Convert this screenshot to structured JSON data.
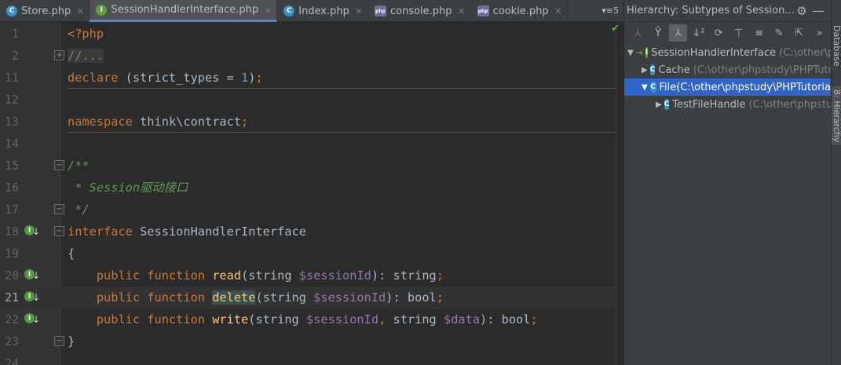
{
  "tabs": [
    {
      "label": "Store.php",
      "icon": "class-icon",
      "type": "class",
      "active": false
    },
    {
      "label": "SessionHandlerInterface.php",
      "icon": "interface-icon",
      "type": "iface",
      "active": true
    },
    {
      "label": "Index.php",
      "icon": "class-icon",
      "type": "class",
      "active": false
    },
    {
      "label": "console.php",
      "icon": "php-file-icon",
      "type": "php",
      "active": false
    },
    {
      "label": "cookie.php",
      "icon": "php-file-icon",
      "type": "php",
      "active": false
    }
  ],
  "tab_close_glyph": "×",
  "tab_overflow": "▾≡5",
  "editor": {
    "lines": [
      {
        "num": "1",
        "html": "<span class='kw'>&lt;?php</span>"
      },
      {
        "num": "2",
        "fold": "+",
        "html": "<span class='fold-box'>//...</span>"
      },
      {
        "num": "11",
        "html": "<span class='kw'>declare</span> (strict_types = <span class='num'>1</span>)<span class='kw'>;</span>"
      },
      {
        "num": "12",
        "html": ""
      },
      {
        "num": "13",
        "html": "<span class='kw'>namespace</span> think\\contract<span class='kw'>;</span>"
      },
      {
        "num": "14",
        "html": ""
      },
      {
        "num": "15",
        "fold": "−",
        "html": "<span class='cmt'>/**</span>"
      },
      {
        "num": "16",
        "html": "<span class='cmt'> * Session驱动接口</span>"
      },
      {
        "num": "17",
        "fold": "−",
        "html": "<span class='cmt'> */</span>"
      },
      {
        "num": "18",
        "mark": true,
        "fold": "−",
        "html": "<span class='kw'>interface</span> SessionHandlerInterface"
      },
      {
        "num": "19",
        "html": "{"
      },
      {
        "num": "20",
        "mark": true,
        "html": "    <span class='kw'>public function</span> <span class='fn'>read</span>(string <span class='var'>$sessionId</span>): string<span class='kw'>;</span>"
      },
      {
        "num": "21",
        "mark": true,
        "current": true,
        "html": "    <span class='kw'>public function</span> <span class='fn hl'>delete</span>(string <span class='var'>$sessionId</span>): bool<span class='kw'>;</span>"
      },
      {
        "num": "22",
        "mark": true,
        "html": "    <span class='kw'>public function</span> <span class='fn'>write</span>(string <span class='var'>$sessionId</span><span class='kw'>,</span> string <span class='var'>$data</span>): bool<span class='kw'>;</span>"
      },
      {
        "num": "23",
        "fold": "−",
        "html": "}"
      },
      {
        "num": "24",
        "html": ""
      }
    ]
  },
  "hierarchy": {
    "title": "Hierarchy:  Subtypes of Session...",
    "toolbar_icons": [
      "type-hierarchy-icon",
      "supertypes-icon",
      "subtypes-icon",
      "sort-alpha-icon",
      "refresh-icon",
      "scope-icon",
      "expand-all-icon",
      "pin-icon",
      "export-icon",
      "more-icon"
    ],
    "toolbar_glyphs": [
      "⅄",
      "Ŷ",
      "⅄",
      "↓²",
      "⟳",
      "⊤",
      "≡",
      "✎",
      "⇱",
      "»"
    ],
    "nodes": [
      {
        "label": "SessionHandlerInterface",
        "path": "(C:\\other\\p",
        "icon": "interface-icon",
        "expanded": true,
        "level": 0,
        "selected": false
      },
      {
        "label": "Cache",
        "path": "(C:\\other\\phpstudy\\PHPTuto",
        "icon": "class-icon",
        "expanded": false,
        "level": 1,
        "selected": false
      },
      {
        "label": "File",
        "path": "(C:\\other\\phpstudy\\PHPTutoria",
        "icon": "class-icon",
        "expanded": true,
        "level": 1,
        "selected": true
      },
      {
        "label": "TestFileHandle",
        "path": "(C:\\other\\phpstu",
        "icon": "class-icon",
        "expanded": false,
        "level": 2,
        "selected": false
      }
    ]
  },
  "side_tabs": [
    "Database",
    "8: Hierarchy"
  ],
  "colors": {
    "accent": "#4a88c7",
    "selection": "#2f65ca",
    "keyword": "#cc7832",
    "function": "#ffc66d",
    "variable": "#9876aa",
    "comment": "#629755"
  }
}
